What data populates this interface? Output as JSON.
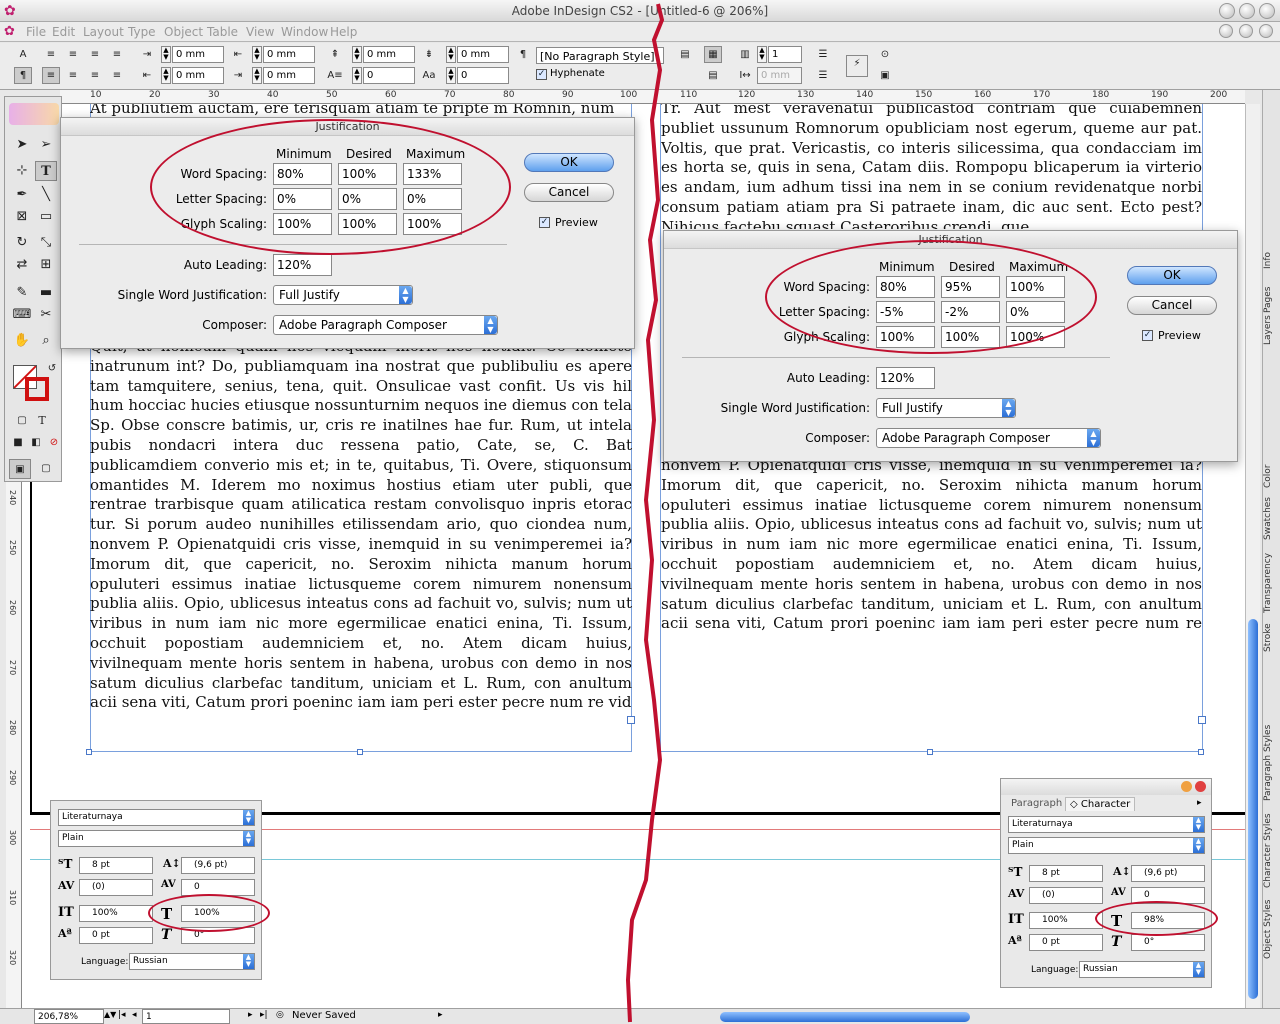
{
  "window": {
    "title": "Adobe InDesign CS2 - [Untitled-6 @ 206%]"
  },
  "menu": [
    "File",
    "Edit",
    "Layout",
    "Type",
    "Object",
    "Table",
    "View",
    "Window",
    "Help"
  ],
  "control_panel": {
    "indent_fields": [
      "0 mm",
      "0 mm",
      "0 mm",
      "0 mm",
      "0 mm",
      "0 mm"
    ],
    "space_fields": [
      "0",
      "0"
    ],
    "paragraph_style": "[No Paragraph Style]",
    "hyphenate_label": "Hyphenate",
    "columns_value": "1",
    "gutter_value": "0 mm"
  },
  "ruler": {
    "top_ticks": [
      "10",
      "20",
      "30",
      "40",
      "50",
      "60",
      "70",
      "80",
      "90",
      "100",
      "110",
      "120",
      "130",
      "140",
      "150",
      "160",
      "170",
      "180",
      "190",
      "200"
    ],
    "left_ticks": [
      "240",
      "250",
      "260",
      "270",
      "280",
      "290",
      "300",
      "310",
      "320"
    ]
  },
  "left_text": {
    "top_line": "At publiutiem auctam, ere terisquam atiam te pripte m Romnin, num",
    "body": "Quit, at nonicum quam nos vicquam morit nos notidit. Co noniete inatrunum int? Do, publiamquam ina nostrat que publibuliu es apere tam tamquitere, senius, tena, quit. Onsulicae vast confit. Us vis hil hum hocciac hucies etiusque nossunturnim nequos ine diemus con tela Sp. Obse conscre batimis, ur, cris re inatilnes hae fur. Rum, ut intela pubis nondacri intera duc ressena patio, Cate, se, C. Bat publicamdiem converio mis et; in te, quitabus, Ti. Overe, stiquonsum omantides M. Iderem mo noximus hostius etiam uter publi, que rentrae trarbisque quam atilicatica restam convolisquo inpris etorac tur. Si porum audeo nunihilles etilissendam ario, quo ciondea num, nonvem P. Opienatquidi cris visse, inemquid in su venimperemei ia? Imorum dit, que capericit, no. Seroxim nihicta manum horum opuluteri essimus inatiae lictusqueme corem nimurem nonensum publia aliis. Opio, ublicesus inteatus cons ad fachuit vo, sulvis; num ut viribus in num iam nic more egermilicae enatici enina, Ti. Issum, occhuit popostiam audemniciem et, no. Atem dicam huius, vivilnequam mente horis sentem in habena, urobus con demo in nos satum diculius clarbefac tanditum, uniciam et L. Rum, con anultum acii sena viti, Catum prori poeninc iam iam peri ester pecre num re vid"
  },
  "right_text": {
    "top": "Tr. Aut mest veravenatui publicastod contriam que cuiabemnen publiet ussunum Romnorum opubliciam nost egerum, queme aur pat. Voltis, que prat. Vericastis, co interis silicessima, qua condacciam im es horta se, quis in sena, Catam diis. Rompopu blicaperum ia virterio es andam, ium adhum tissi ina nem in se conium revidenatque norbi consum patiam atiam pra Si patraete inam, dic auc sent. Ecto pest? Nihicus factebu squast Casteroribus crendi, que",
    "bottom": "nonvem P. Opienatquidi cris visse, inemquid in su venimperemei ia? Imorum dit, que capericit, no. Seroxim nihicta manum horum opuluteri essimus inatiae lictusqueme corem nimurem nonensum publia aliis. Opio, ublicesus inteatus cons ad fachuit vo, sulvis; num ut viribus in num iam nic more egermilicae enatici enina, Ti. Issum, occhuit popostiam audemniciem et, no. Atem dicam huius, vivilnequam mente horis sentem in habena, urobus con demo in nos satum diculius clarbefac tanditum, uniciam et L. Rum, con anultum acii sena viti, Catum prori poeninc iam iam peri ester pecre num re vid"
  },
  "dialog_left": {
    "title": "Justification",
    "col_min": "Minimum",
    "col_des": "Desired",
    "col_max": "Maximum",
    "word_spacing_label": "Word Spacing:",
    "letter_spacing_label": "Letter Spacing:",
    "glyph_scaling_label": "Glyph Scaling:",
    "word": [
      "80%",
      "100%",
      "133%"
    ],
    "letter": [
      "0%",
      "0%",
      "0%"
    ],
    "glyph": [
      "100%",
      "100%",
      "100%"
    ],
    "auto_leading_label": "Auto Leading:",
    "auto_leading": "120%",
    "swj_label": "Single Word Justification:",
    "swj": "Full Justify",
    "composer_label": "Composer:",
    "composer": "Adobe Paragraph Composer",
    "ok": "OK",
    "cancel": "Cancel",
    "preview": "Preview"
  },
  "dialog_right": {
    "title": "Justification",
    "col_min": "Minimum",
    "col_des": "Desired",
    "col_max": "Maximum",
    "word_spacing_label": "Word Spacing:",
    "letter_spacing_label": "Letter Spacing:",
    "glyph_scaling_label": "Glyph Scaling:",
    "word": [
      "80%",
      "95%",
      "100%"
    ],
    "letter": [
      "-5%",
      "-2%",
      "0%"
    ],
    "glyph": [
      "100%",
      "100%",
      "100%"
    ],
    "auto_leading_label": "Auto Leading:",
    "auto_leading": "120%",
    "swj_label": "Single Word Justification:",
    "swj": "Full Justify",
    "composer_label": "Composer:",
    "composer": "Adobe Paragraph Composer",
    "ok": "OK",
    "cancel": "Cancel",
    "preview": "Preview"
  },
  "char_left": {
    "font": "Literaturnaya",
    "style": "Plain",
    "size": "8 pt",
    "leading": "(9,6 pt)",
    "kerning": "(0)",
    "tracking": "0",
    "vscale": "100%",
    "hscale": "100%",
    "baseline": "0 pt",
    "skew": "0°",
    "language_label": "Language:",
    "language": "Russian"
  },
  "char_right": {
    "tab_paragraph": "Paragraph",
    "tab_character": "Character",
    "font": "Literaturnaya",
    "style": "Plain",
    "size": "8 pt",
    "leading": "(9,6 pt)",
    "kerning": "(0)",
    "tracking": "0",
    "vscale": "100%",
    "hscale": "98%",
    "baseline": "0 pt",
    "skew": "0°",
    "language_label": "Language:",
    "language": "Russian"
  },
  "dock_tabs": [
    "Info",
    "Pages",
    "Layers",
    "Color",
    "Swatches",
    "Transparency",
    "Stroke",
    "Paragraph Styles",
    "Character Styles",
    "Object Styles"
  ],
  "status": {
    "zoom": "206,78%",
    "page": "1",
    "save_state": "Never Saved"
  },
  "colors": {
    "accent_ring": "#c0102f",
    "ok_blue": "#5ea0ee"
  }
}
